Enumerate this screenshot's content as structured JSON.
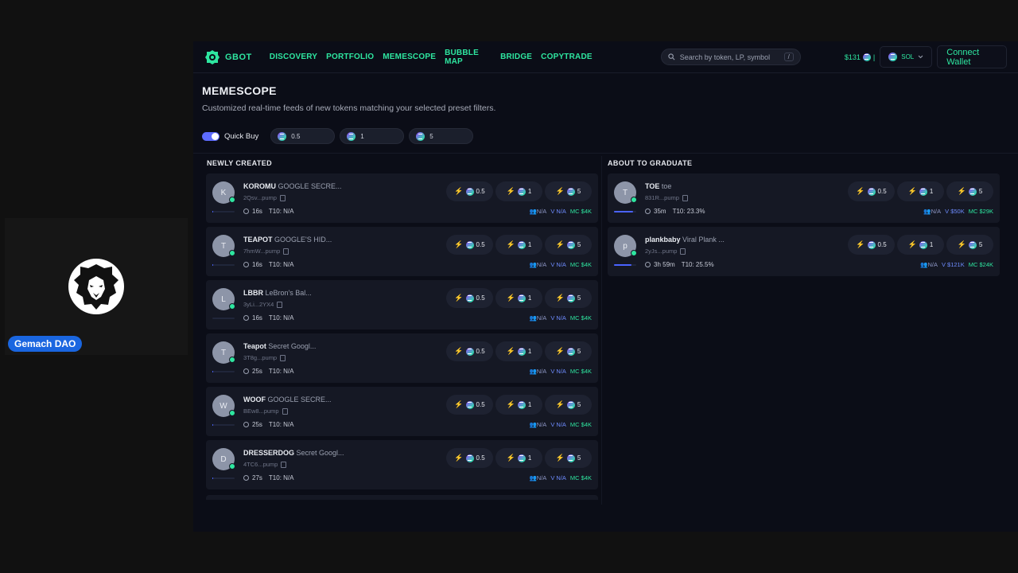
{
  "participant": {
    "name": "Gemach DAO"
  },
  "nav": {
    "brand": "GBOT",
    "links": [
      "DISCOVERY",
      "PORTFOLIO",
      "MEMESCOPE",
      "BUBBLE MAP",
      "BRIDGE",
      "COPYTRADE"
    ],
    "search_placeholder": "Search by token, LP, symbol",
    "search_shortcut": "/",
    "balance": "$131",
    "balance_sep": "|",
    "chain": "SOL",
    "connect_label": "Connect Wallet"
  },
  "page": {
    "title": "MEMESCOPE",
    "subtitle": "Customized real-time feeds of new tokens matching your selected preset filters."
  },
  "quick_buy": {
    "label": "Quick Buy",
    "enabled": true,
    "presets": [
      "0.5",
      "1",
      "5"
    ]
  },
  "columns": {
    "newly_created": {
      "title": "NEWLY CREATED",
      "items": [
        {
          "initial": "K",
          "symbol": "KOROMU",
          "name": "GOOGLE SECRE...",
          "address": "2Qsv...pump",
          "age": "16s",
          "top10": "T10: N/A",
          "holders": "N/A",
          "volume": "V N/A",
          "mc": "MC $4K",
          "progress": 0.02
        },
        {
          "initial": "T",
          "symbol": "TEAPOT",
          "name": "GOOGLE'S HID...",
          "address": "7hmW...pump",
          "age": "16s",
          "top10": "T10: N/A",
          "holders": "N/A",
          "volume": "V N/A",
          "mc": "MC $4K",
          "progress": 0.02
        },
        {
          "initial": "L",
          "symbol": "LBBR",
          "name": "LeBron's Bal...",
          "address": "3yLi...2YX4",
          "age": "16s",
          "top10": "T10: N/A",
          "holders": "N/A",
          "volume": "V N/A",
          "mc": "MC $4K",
          "progress": 0.0
        },
        {
          "initial": "T",
          "symbol": "Teapot",
          "name": "Secret Googl...",
          "address": "3T8g...pump",
          "age": "25s",
          "top10": "T10: N/A",
          "holders": "N/A",
          "volume": "V N/A",
          "mc": "MC $4K",
          "progress": 0.02
        },
        {
          "initial": "W",
          "symbol": "WOOF",
          "name": "GOOGLE SECRE...",
          "address": "BEw8...pump",
          "age": "25s",
          "top10": "T10: N/A",
          "holders": "N/A",
          "volume": "V N/A",
          "mc": "MC $4K",
          "progress": 0.02
        },
        {
          "initial": "D",
          "symbol": "DRESSERDOG",
          "name": "Secret Googl...",
          "address": "4TC6...pump",
          "age": "27s",
          "top10": "T10: N/A",
          "holders": "N/A",
          "volume": "V N/A",
          "mc": "MC $4K",
          "progress": 0.02
        }
      ]
    },
    "about_to_graduate": {
      "title": "ABOUT TO GRADUATE",
      "items": [
        {
          "initial": "T",
          "symbol": "TOE",
          "name": "toe",
          "address": "831R...pump",
          "age": "35m",
          "top10": "T10: 23.3%",
          "holders": "N/A",
          "volume": "V $50K",
          "mc": "MC $29K",
          "progress": 0.85
        },
        {
          "initial": "p",
          "symbol": "plankbaby",
          "name": "Viral Plank ...",
          "address": "2yJs...pump",
          "age": "3h 59m",
          "top10": "T10: 25.5%",
          "holders": "N/A",
          "volume": "V $121K",
          "mc": "MC $24K",
          "progress": 0.8
        }
      ]
    }
  },
  "colors": {
    "accent": "#2ee6a0",
    "volume": "#6e8cff",
    "toggle": "#5e6cff",
    "badge": "#1a66e0"
  },
  "icons": [
    "lion-avatar-icon",
    "gbot-logo-icon",
    "search-icon",
    "solana-icon",
    "chevron-down-icon",
    "lightning-icon",
    "copy-icon",
    "clock-icon",
    "holders-icon"
  ]
}
